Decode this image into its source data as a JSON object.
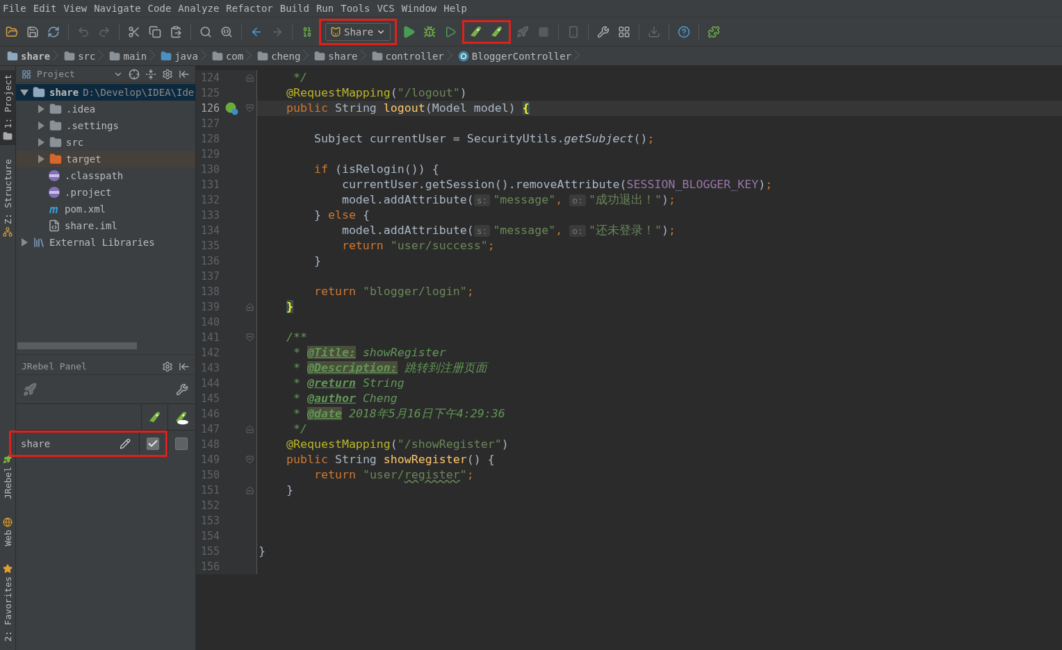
{
  "menu": [
    "File",
    "Edit",
    "View",
    "Navigate",
    "Code",
    "Analyze",
    "Refactor",
    "Build",
    "Run",
    "Tools",
    "VCS",
    "Window",
    "Help"
  ],
  "toolbar": {
    "run_config": {
      "label": "Share",
      "highlighted": true
    },
    "jrebel_group": {
      "highlighted": true
    }
  },
  "breadcrumbs": [
    {
      "label": "share",
      "kind": "module"
    },
    {
      "label": "src",
      "kind": "folder"
    },
    {
      "label": "main",
      "kind": "folder"
    },
    {
      "label": "java",
      "kind": "source"
    },
    {
      "label": "com",
      "kind": "package"
    },
    {
      "label": "cheng",
      "kind": "package"
    },
    {
      "label": "share",
      "kind": "package"
    },
    {
      "label": "controller",
      "kind": "package"
    },
    {
      "label": "BloggerController",
      "kind": "class"
    }
  ],
  "side_tabs_top": [
    {
      "label": "1: Project",
      "selected": true
    },
    {
      "label": "Z: Structure",
      "selected": false
    }
  ],
  "side_tabs_bottom": [
    {
      "label": "JRebel",
      "selected": false
    },
    {
      "label": "Web",
      "selected": false
    },
    {
      "label": "2: Favorites",
      "selected": false
    }
  ],
  "project_panel": {
    "title": "Project",
    "tree": [
      {
        "label": "share",
        "path": "D:\\Develop\\IDEA\\Ide",
        "kind": "module",
        "expanded": true,
        "selected": true,
        "children": [
          {
            "label": ".idea",
            "kind": "folder",
            "expanded": false,
            "selected": false
          },
          {
            "label": ".settings",
            "kind": "folder",
            "expanded": false,
            "selected": false
          },
          {
            "label": "src",
            "kind": "folder",
            "expanded": false,
            "selected": false
          },
          {
            "label": "target",
            "kind": "excluded-folder",
            "expanded": false,
            "selected": false
          },
          {
            "label": ".classpath",
            "kind": "eclipse-file",
            "selected": false
          },
          {
            "label": ".project",
            "kind": "eclipse-file",
            "selected": false
          },
          {
            "label": "pom.xml",
            "kind": "maven-file",
            "selected": false
          },
          {
            "label": "share.iml",
            "kind": "iml-file",
            "selected": false
          }
        ]
      },
      {
        "label": "External Libraries",
        "kind": "library",
        "expanded": false,
        "selected": false
      }
    ]
  },
  "jrebel_panel": {
    "title": "JRebel Panel",
    "rows": [
      {
        "name": "share",
        "highlighted": true,
        "jrebel_checked": true,
        "remote_checked": false
      }
    ]
  },
  "editor": {
    "lines": [
      {
        "number": "124",
        "kind": "fold-end",
        "current": false,
        "tokens": [
          {
            "kind": "doc",
            "s": "     */"
          }
        ]
      },
      {
        "number": "125",
        "kind": "code",
        "current": false,
        "tokens": [
          {
            "kind": "ann",
            "s": "    @RequestMapping"
          },
          {
            "kind": "plain",
            "s": "("
          },
          {
            "kind": "str",
            "s": "\"/logout\""
          },
          {
            "kind": "plain",
            "s": ")"
          }
        ]
      },
      {
        "number": "126",
        "kind": "fold-start",
        "current": true,
        "gutter_icon": true,
        "tokens": [
          {
            "kind": "kw",
            "s": "    public"
          },
          {
            "kind": "plain",
            "s": " String "
          },
          {
            "kind": "fn",
            "s": "logout"
          },
          {
            "kind": "plain",
            "s": "(Model model) "
          },
          {
            "kind": "brace",
            "s": "{"
          }
        ]
      },
      {
        "number": "127",
        "kind": "code",
        "current": false
      },
      {
        "number": "128",
        "kind": "code",
        "current": false,
        "tokens": [
          {
            "kind": "plain",
            "s": "        Subject currentUser = SecurityUtils."
          },
          {
            "kind": "static",
            "s": "getSubject"
          },
          {
            "kind": "plain",
            "s": "()"
          },
          {
            "kind": "punct",
            "s": ";"
          }
        ]
      },
      {
        "number": "129",
        "kind": "code",
        "current": false
      },
      {
        "number": "130",
        "kind": "code",
        "current": false,
        "tokens": [
          {
            "kind": "kw",
            "s": "        if"
          },
          {
            "kind": "plain",
            "s": " (isRelogin()) {"
          }
        ]
      },
      {
        "number": "131",
        "kind": "code",
        "current": false,
        "tokens": [
          {
            "kind": "plain",
            "s": "            currentUser.getSession().removeAttribute("
          },
          {
            "kind": "const",
            "s": "SESSION_BLOGGER_KEY"
          },
          {
            "kind": "plain",
            "s": ")"
          },
          {
            "kind": "punct",
            "s": ";"
          }
        ]
      },
      {
        "number": "132",
        "kind": "code",
        "current": false,
        "tokens": [
          {
            "kind": "plain",
            "s": "            model.addAttribute("
          },
          {
            "kind": "hint",
            "s": "s:"
          },
          {
            "kind": "str",
            "s": "\"message\""
          },
          {
            "kind": "punct",
            "s": ","
          },
          {
            "kind": "hint",
            "s": "o:"
          },
          {
            "kind": "str",
            "s": "\"成功退出！\""
          },
          {
            "kind": "plain",
            "s": ")"
          },
          {
            "kind": "punct",
            "s": ";"
          }
        ]
      },
      {
        "number": "133",
        "kind": "code",
        "current": false,
        "tokens": [
          {
            "kind": "plain",
            "s": "        } "
          },
          {
            "kind": "kw",
            "s": "else"
          },
          {
            "kind": "plain",
            "s": " {"
          }
        ]
      },
      {
        "number": "134",
        "kind": "code",
        "current": false,
        "tokens": [
          {
            "kind": "plain",
            "s": "            model.addAttribute("
          },
          {
            "kind": "hint",
            "s": "s:"
          },
          {
            "kind": "str",
            "s": "\"message\""
          },
          {
            "kind": "punct",
            "s": ","
          },
          {
            "kind": "hint",
            "s": "o:"
          },
          {
            "kind": "str",
            "s": "\"还未登录！\""
          },
          {
            "kind": "plain",
            "s": ")"
          },
          {
            "kind": "punct",
            "s": ";"
          }
        ]
      },
      {
        "number": "135",
        "kind": "code",
        "current": false,
        "tokens": [
          {
            "kind": "kw",
            "s": "            return"
          },
          {
            "kind": "str",
            "s": " \"user/success\""
          },
          {
            "kind": "punct",
            "s": ";"
          }
        ]
      },
      {
        "number": "136",
        "kind": "code",
        "current": false,
        "tokens": [
          {
            "kind": "plain",
            "s": "        }"
          }
        ]
      },
      {
        "number": "137",
        "kind": "code",
        "current": false
      },
      {
        "number": "138",
        "kind": "code",
        "current": false,
        "tokens": [
          {
            "kind": "kw",
            "s": "        return"
          },
          {
            "kind": "str",
            "s": " \"blogger/login\""
          },
          {
            "kind": "punct",
            "s": ";"
          }
        ]
      },
      {
        "number": "139",
        "kind": "fold-end",
        "current": false,
        "tokens": [
          {
            "kind": "brace",
            "s": "    }"
          }
        ]
      },
      {
        "number": "140",
        "kind": "code",
        "current": false
      },
      {
        "number": "141",
        "kind": "fold-start",
        "current": false,
        "tokens": [
          {
            "kind": "doc",
            "s": "    /**"
          }
        ]
      },
      {
        "number": "142",
        "kind": "code",
        "current": false,
        "tokens": [
          {
            "kind": "doc",
            "s": "     * "
          },
          {
            "kind": "doctag-marked",
            "s": "@Title:"
          },
          {
            "kind": "doc",
            "s": " showRegister"
          }
        ]
      },
      {
        "number": "143",
        "kind": "code",
        "current": false,
        "tokens": [
          {
            "kind": "doc",
            "s": "     * "
          },
          {
            "kind": "doctag-marked",
            "s": "@Description:"
          },
          {
            "kind": "doc",
            "s": " 跳转到注册页面"
          }
        ]
      },
      {
        "number": "144",
        "kind": "code",
        "current": false,
        "tokens": [
          {
            "kind": "doc",
            "s": "     * "
          },
          {
            "kind": "doctag",
            "s": "@return"
          },
          {
            "kind": "doc",
            "s": " String"
          }
        ]
      },
      {
        "number": "145",
        "kind": "code",
        "current": false,
        "tokens": [
          {
            "kind": "doc",
            "s": "     * "
          },
          {
            "kind": "doctag",
            "s": "@author"
          },
          {
            "kind": "doc",
            "s": " Cheng"
          }
        ]
      },
      {
        "number": "146",
        "kind": "code",
        "current": false,
        "tokens": [
          {
            "kind": "doc",
            "s": "     * "
          },
          {
            "kind": "doctag-marked",
            "s": "@date"
          },
          {
            "kind": "doc",
            "s": " 2018年5月16日下午4:29:36"
          }
        ]
      },
      {
        "number": "147",
        "kind": "fold-end",
        "current": false,
        "tokens": [
          {
            "kind": "doc",
            "s": "     */"
          }
        ]
      },
      {
        "number": "148",
        "kind": "code",
        "current": false,
        "tokens": [
          {
            "kind": "ann",
            "s": "    @RequestMapping"
          },
          {
            "kind": "plain",
            "s": "("
          },
          {
            "kind": "str",
            "s": "\"/showRegister\""
          },
          {
            "kind": "plain",
            "s": ")"
          }
        ]
      },
      {
        "number": "149",
        "kind": "fold-start",
        "current": false,
        "tokens": [
          {
            "kind": "kw",
            "s": "    public"
          },
          {
            "kind": "plain",
            "s": " String "
          },
          {
            "kind": "fn",
            "s": "showRegister"
          },
          {
            "kind": "plain",
            "s": "() {"
          }
        ]
      },
      {
        "number": "150",
        "kind": "code",
        "current": false,
        "tokens": [
          {
            "kind": "kw",
            "s": "        return"
          },
          {
            "kind": "str",
            "s": " \"user/"
          },
          {
            "kind": "typo",
            "s": "register"
          },
          {
            "kind": "str",
            "s": "\""
          },
          {
            "kind": "punct",
            "s": ";"
          }
        ]
      },
      {
        "number": "151",
        "kind": "fold-end",
        "current": false,
        "tokens": [
          {
            "kind": "plain",
            "s": "    }"
          }
        ]
      },
      {
        "number": "152",
        "kind": "code",
        "current": false
      },
      {
        "number": "153",
        "kind": "code",
        "current": false
      },
      {
        "number": "154",
        "kind": "code",
        "current": false
      },
      {
        "number": "155",
        "kind": "code",
        "current": false,
        "tokens": [
          {
            "kind": "plain",
            "s": "}"
          }
        ]
      },
      {
        "number": "156",
        "kind": "code",
        "current": false
      }
    ]
  }
}
